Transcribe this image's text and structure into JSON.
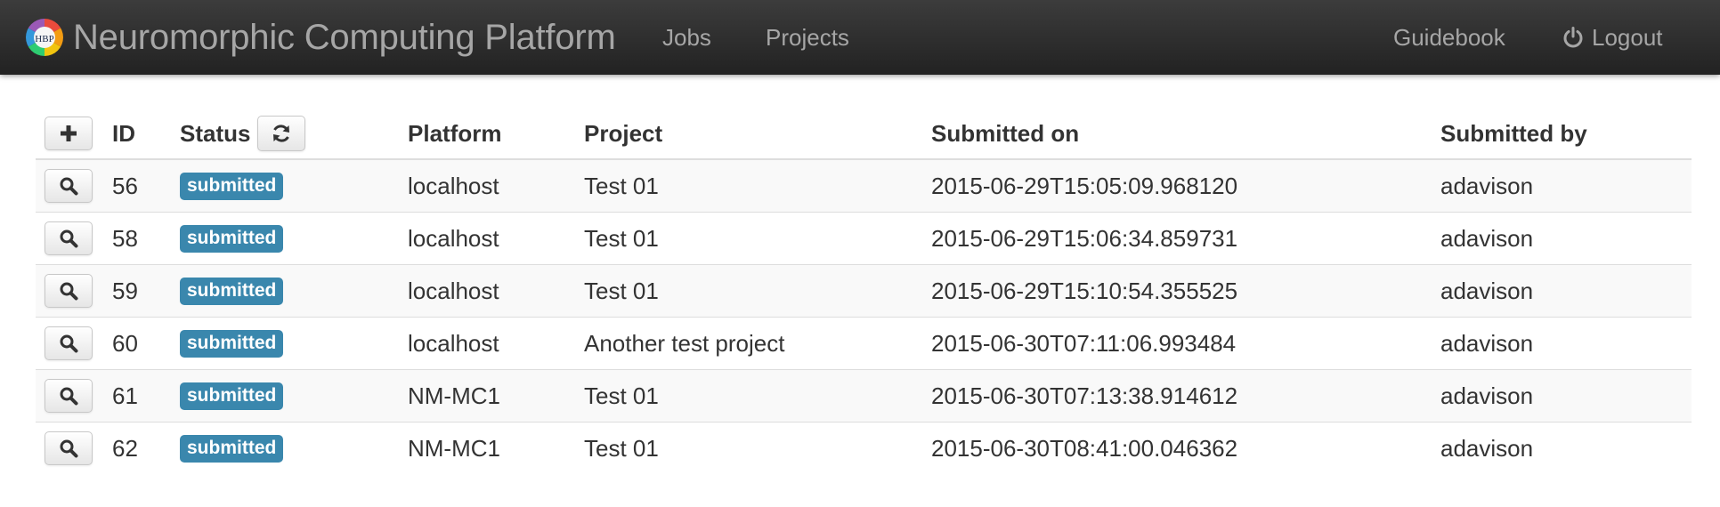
{
  "navbar": {
    "brand": "Neuromorphic Computing Platform",
    "logo_text": "HBP",
    "links": {
      "jobs": "Jobs",
      "projects": "Projects",
      "guidebook": "Guidebook",
      "logout": "Logout"
    }
  },
  "table": {
    "headers": {
      "id": "ID",
      "status": "Status",
      "platform": "Platform",
      "project": "Project",
      "submitted_on": "Submitted on",
      "submitted_by": "Submitted by"
    },
    "header_buttons": {
      "add": "plus-icon",
      "refresh": "refresh-icon"
    },
    "rows": [
      {
        "id": "56",
        "status": "submitted",
        "platform": "localhost",
        "project": "Test 01",
        "submitted_on": "2015-06-29T15:05:09.968120",
        "submitted_by": "adavison"
      },
      {
        "id": "58",
        "status": "submitted",
        "platform": "localhost",
        "project": "Test 01",
        "submitted_on": "2015-06-29T15:06:34.859731",
        "submitted_by": "adavison"
      },
      {
        "id": "59",
        "status": "submitted",
        "platform": "localhost",
        "project": "Test 01",
        "submitted_on": "2015-06-29T15:10:54.355525",
        "submitted_by": "adavison"
      },
      {
        "id": "60",
        "status": "submitted",
        "platform": "localhost",
        "project": "Another test project",
        "submitted_on": "2015-06-30T07:11:06.993484",
        "submitted_by": "adavison"
      },
      {
        "id": "61",
        "status": "submitted",
        "platform": "NM-MC1",
        "project": "Test 01",
        "submitted_on": "2015-06-30T07:13:38.914612",
        "submitted_by": "adavison"
      },
      {
        "id": "62",
        "status": "submitted",
        "platform": "NM-MC1",
        "project": "Test 01",
        "submitted_on": "2015-06-30T08:41:00.046362",
        "submitted_by": "adavison"
      }
    ]
  },
  "colors": {
    "navbar_top": "#3c3c3c",
    "navbar_bottom": "#222222",
    "nav_text": "#a6a6a6",
    "status_label": "#3a87ad",
    "row_stripe": "#f9f9f9"
  }
}
